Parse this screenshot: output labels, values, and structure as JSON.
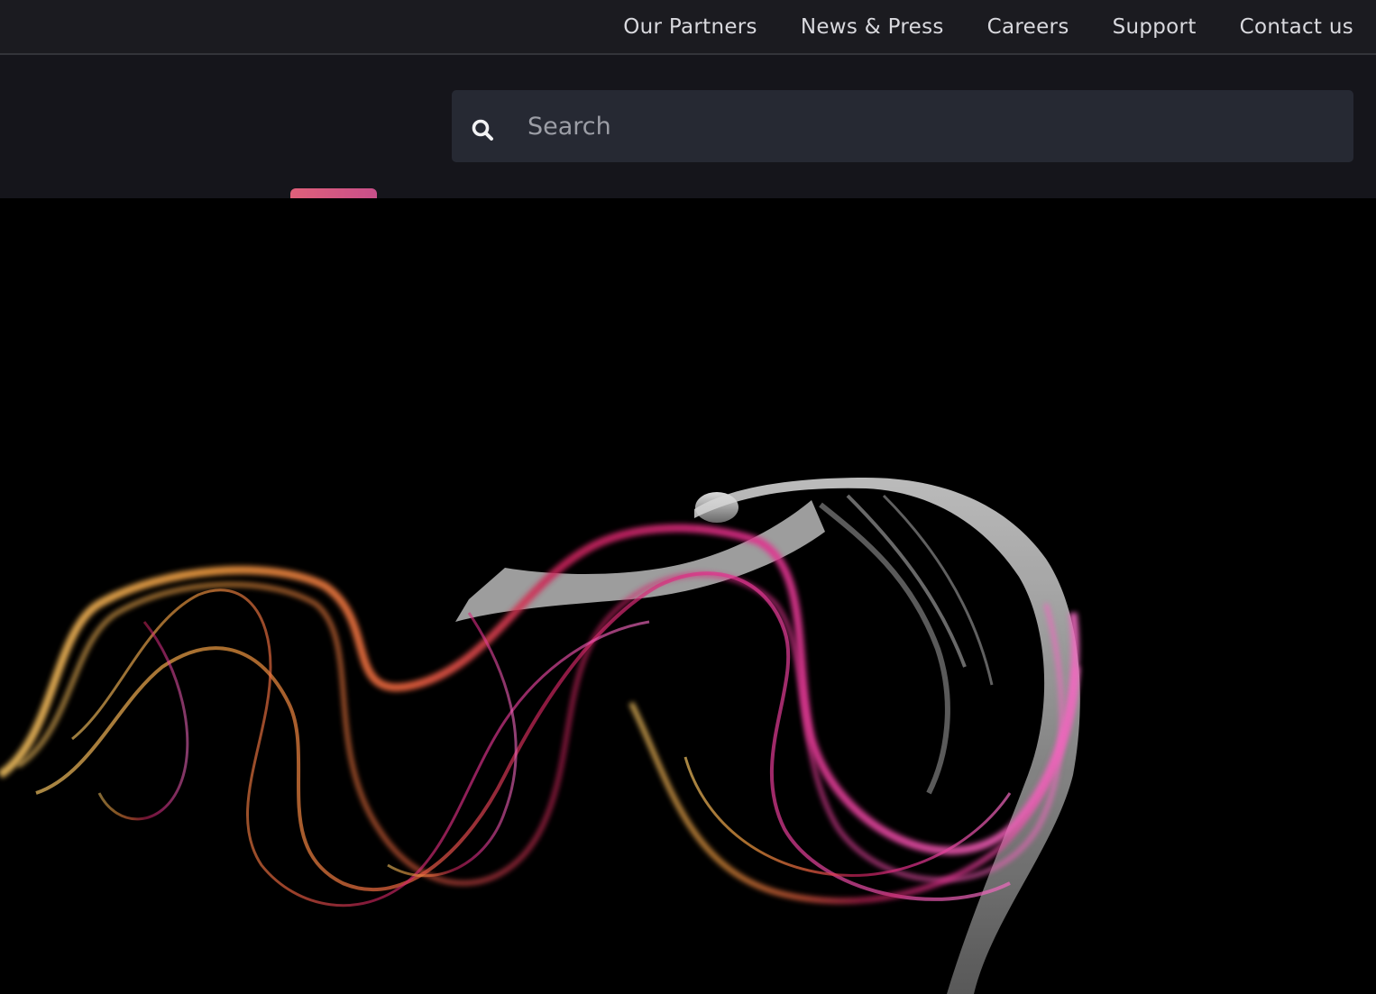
{
  "topnav": {
    "items": [
      {
        "label": "Our Partners"
      },
      {
        "label": "News & Press"
      },
      {
        "label": "Careers"
      },
      {
        "label": "Support"
      },
      {
        "label": "Contact us"
      }
    ]
  },
  "search": {
    "placeholder": "Search",
    "value": "",
    "icon": "search-icon"
  },
  "colors": {
    "topbar_bg": "#1b1b20",
    "header_bg": "#15151b",
    "search_bg": "#262933",
    "accent": "#d95a80",
    "hero_bg": "#000000"
  },
  "hero": {
    "image": "dancer with flowing orange-to-pink smoke ribbons on black background"
  }
}
